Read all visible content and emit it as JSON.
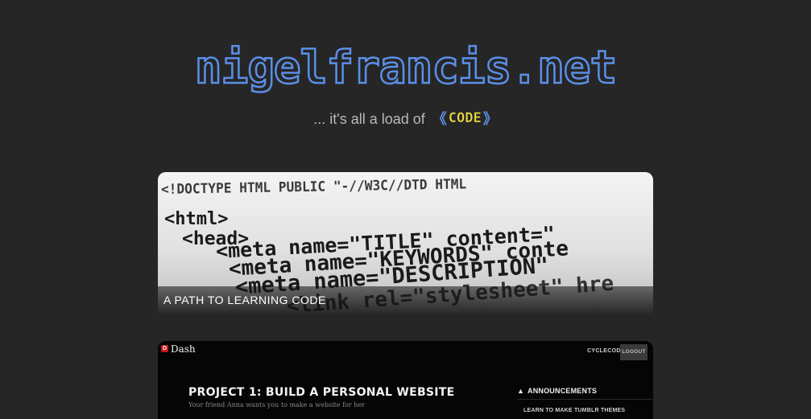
{
  "site": {
    "title": "nigelfrancis.net",
    "tagline_prefix": "... it's all a load of",
    "tagline_chev_left": "《",
    "tagline_code": "CODE",
    "tagline_chev_right": "》"
  },
  "colors": {
    "background": "#262626",
    "accent_blue": "#5b8fe8",
    "accent_yellow": "#f0e03a"
  },
  "cards": [
    {
      "caption": "A PATH TO LEARNING CODE",
      "image_icon": "html-code-photo",
      "code_lines": [
        "<!DOCTYPE HTML PUBLIC \"-//W3C//DTD HTML",
        "<html>",
        "<head>",
        "<meta name=\"TITLE\" content=\"",
        "<meta name=\"KEYWORDS\" conte",
        "<meta name=\"DESCRIPTION\"",
        "<link rel=\"stylesheet\" hre"
      ]
    },
    {
      "app_logo": "D",
      "app_name": "Dash",
      "user": "CYCLECODE",
      "logout": "LOGOUT",
      "project_title": "PROJECT 1: BUILD A PERSONAL WEBSITE",
      "project_subtitle": "Your friend Anna wants you to make a website for her",
      "announcements_icon": "megaphone-icon",
      "announcements_label": "ANNOUNCEMENTS",
      "announcement_link": "LEARN TO MAKE TUMBLR THEMES"
    }
  ]
}
